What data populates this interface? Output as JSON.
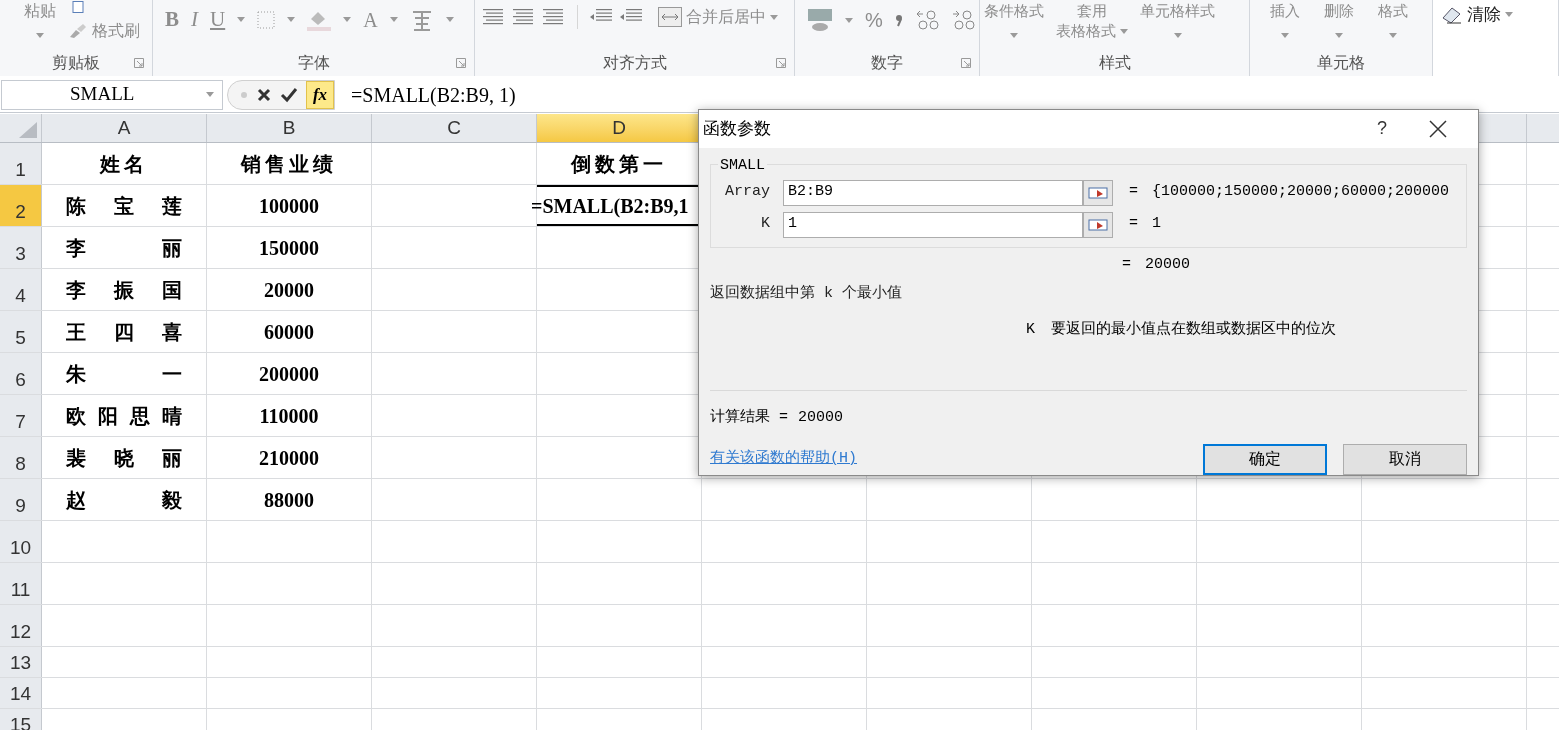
{
  "ribbon": [
    {
      "kind": "clipboard",
      "title": "剪贴板",
      "disabled": true,
      "buttons": [
        "粘贴",
        "格式刷"
      ]
    },
    {
      "kind": "font",
      "title": "字体",
      "disabled": true,
      "buttons": [
        "B",
        "I",
        "U",
        "A"
      ]
    },
    {
      "kind": "alignment",
      "title": "对齐方式",
      "disabled": true,
      "buttons": [
        "合并后居中"
      ]
    },
    {
      "kind": "number",
      "title": "数字",
      "disabled": true,
      "buttons": [
        "%"
      ]
    },
    {
      "kind": "styles",
      "title": "样式",
      "disabled": true,
      "buttons": [
        "条件格式",
        "套用",
        "表格格式",
        "单元格样式"
      ]
    },
    {
      "kind": "cells",
      "title": "单元格",
      "disabled": true,
      "buttons": [
        "插入",
        "删除",
        "格式"
      ]
    },
    {
      "kind": "editing",
      "disabled": false,
      "buttons": [
        "清除"
      ]
    }
  ],
  "formula_bar": {
    "name_box": "SMALL",
    "function_button": "fx",
    "formula": "=SMALL(B2:B9, 1)"
  },
  "sheet": {
    "columns": [
      {
        "label": "A",
        "selected": false
      },
      {
        "label": "B",
        "selected": false
      },
      {
        "label": "C",
        "selected": false
      },
      {
        "label": "D",
        "selected": true
      }
    ],
    "rows": [
      {
        "number": "1",
        "selected": false,
        "cells": [
          "姓名",
          "销售业绩",
          "",
          "倒数第一"
        ]
      },
      {
        "number": "2",
        "selected": true,
        "cells": [
          "陈宝莲",
          "100000",
          "",
          "=SMALL(B2:B9,1"
        ]
      },
      {
        "number": "3",
        "selected": false,
        "cells": [
          "李丽",
          "150000",
          "",
          ""
        ]
      },
      {
        "number": "4",
        "selected": false,
        "cells": [
          "李振国",
          "20000",
          "",
          ""
        ]
      },
      {
        "number": "5",
        "selected": false,
        "cells": [
          "王四喜",
          "60000",
          "",
          ""
        ]
      },
      {
        "number": "6",
        "selected": false,
        "cells": [
          "朱一",
          "200000",
          "",
          ""
        ]
      },
      {
        "number": "7",
        "selected": false,
        "cells": [
          "欧阳思晴",
          "110000",
          "",
          ""
        ]
      },
      {
        "number": "8",
        "selected": false,
        "cells": [
          "裴晓丽",
          "210000",
          "",
          ""
        ]
      },
      {
        "number": "9",
        "selected": false,
        "cells": [
          "赵毅",
          "88000",
          "",
          ""
        ]
      },
      {
        "number": "10",
        "selected": false,
        "cells": [
          "",
          "",
          "",
          ""
        ]
      },
      {
        "number": "11",
        "selected": false,
        "cells": [
          "",
          "",
          "",
          ""
        ]
      },
      {
        "number": "12",
        "selected": false,
        "cells": [
          "",
          "",
          "",
          ""
        ]
      },
      {
        "number": "13",
        "selected": false,
        "cells": [
          "",
          "",
          "",
          ""
        ]
      },
      {
        "number": "14",
        "selected": false,
        "cells": [
          "",
          "",
          "",
          ""
        ]
      },
      {
        "number": "15",
        "selected": false,
        "cells": [
          "",
          "",
          "",
          ""
        ]
      }
    ]
  },
  "dialog": {
    "title": "函数参数",
    "help": "?",
    "function_name": "SMALL",
    "arguments": [
      {
        "label": "Array",
        "value": "B2:B9",
        "equals": "=",
        "result": "{100000;150000;20000;60000;200000"
      },
      {
        "label": "K",
        "value": "1",
        "equals": "=",
        "result": "1"
      }
    ],
    "formula_equals": "=",
    "formula_result": "20000",
    "description": "返回数据组中第 k 个最小值",
    "argument_help_name": "K",
    "argument_help": "要返回的最小值点在数组或数据区中的位次",
    "result_label": "计算结果 =",
    "result": "20000",
    "help_link": "有关该函数的帮助(H)",
    "buttons": [
      {
        "label": "确定",
        "default": true
      },
      {
        "label": "取消",
        "default": false
      }
    ]
  }
}
